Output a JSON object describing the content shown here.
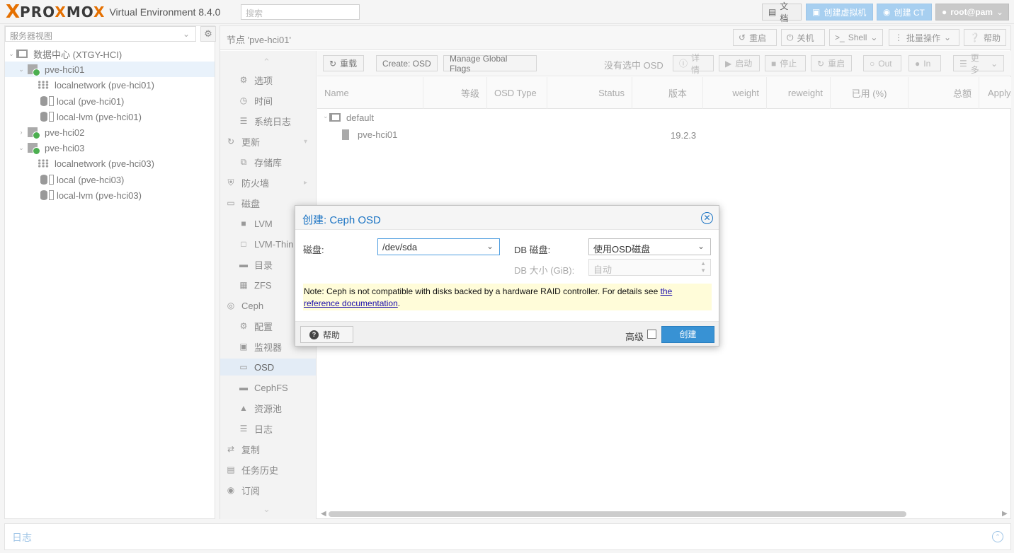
{
  "header": {
    "logo_x": "X",
    "logo_brand": "PROXMOX",
    "product": "Virtual Environment 8.4.0",
    "search_placeholder": "搜索",
    "docs_label": "文档",
    "create_vm_label": "创建虚拟机",
    "create_ct_label": "创建 CT",
    "user_label": "root@pam"
  },
  "tree": {
    "view_label": "服务器视图",
    "items": [
      {
        "label": "数据中心 (XTGY-HCI)"
      },
      {
        "label": "pve-hci01"
      },
      {
        "label": "localnetwork (pve-hci01)"
      },
      {
        "label": "local (pve-hci01)"
      },
      {
        "label": "local-lvm (pve-hci01)"
      },
      {
        "label": "pve-hci02"
      },
      {
        "label": "pve-hci03"
      },
      {
        "label": "localnetwork (pve-hci03)"
      },
      {
        "label": "local (pve-hci03)"
      },
      {
        "label": "local-lvm (pve-hci03)"
      }
    ]
  },
  "node": {
    "title": "节点 'pve-hci01'",
    "reboot": "重启",
    "shutdown": "关机",
    "shell": "Shell",
    "bulk": "批量操作",
    "help": "帮助"
  },
  "menu": {
    "items": [
      {
        "label": "选项"
      },
      {
        "label": "时间"
      },
      {
        "label": "系统日志"
      },
      {
        "label": "更新"
      },
      {
        "label": "存储库"
      },
      {
        "label": "防火墙"
      },
      {
        "label": "磁盘"
      },
      {
        "label": "LVM"
      },
      {
        "label": "LVM-Thin"
      },
      {
        "label": "目录"
      },
      {
        "label": "ZFS"
      },
      {
        "label": "Ceph"
      },
      {
        "label": "配置"
      },
      {
        "label": "监视器"
      },
      {
        "label": "OSD"
      },
      {
        "label": "CephFS"
      },
      {
        "label": "资源池"
      },
      {
        "label": "日志"
      },
      {
        "label": "复制"
      },
      {
        "label": "任务历史"
      },
      {
        "label": "订阅"
      }
    ]
  },
  "osd": {
    "reload": "重载",
    "create_osd": "Create: OSD",
    "manage_flags": "Manage Global Flags",
    "no_selection": "没有选中 OSD",
    "details": "详情",
    "start": "启动",
    "stop": "停止",
    "restart": "重启",
    "out": "Out",
    "in": "In",
    "more": "更多",
    "columns": [
      "Name",
      "等级",
      "OSD Type",
      "Status",
      "版本",
      "weight",
      "reweight",
      "已用 (%)",
      "总额",
      "Apply/Commit Latency"
    ],
    "rows": [
      {
        "name": "default",
        "version": ""
      },
      {
        "name": "pve-hci01",
        "version": "19.2.3"
      }
    ]
  },
  "log": {
    "title": "日志"
  },
  "dialog": {
    "title": "创建: Ceph OSD",
    "disk_label": "磁盘:",
    "disk_value": "/dev/sda",
    "db_disk_label": "DB 磁盘:",
    "db_disk_value": "使用OSD磁盘",
    "db_size_label": "DB 大小 (GiB):",
    "db_size_value": "自动",
    "note_prefix": "Note: Ceph is not compatible with disks backed by a hardware RAID controller. For details see ",
    "note_link_1": "the",
    "note_link_2": "reference documentation",
    "note_suffix": ".",
    "help_label": "帮助",
    "advanced_label": "高级",
    "create_label": "创建"
  }
}
